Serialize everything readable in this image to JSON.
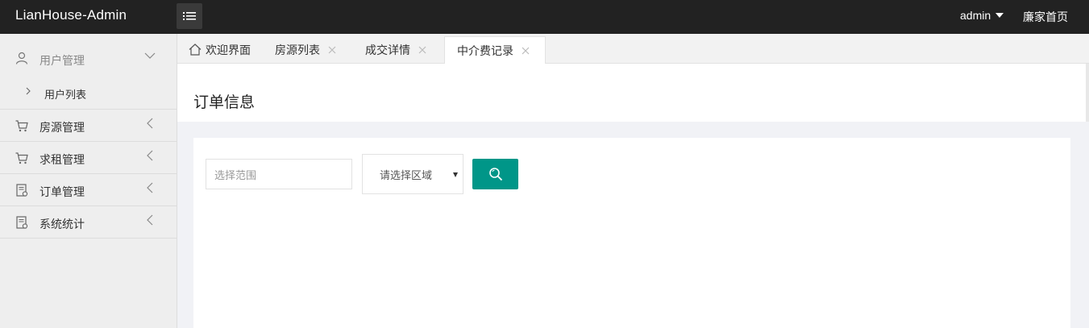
{
  "app": {
    "brand": "LianHouse-Admin",
    "user": "admin",
    "home_link": "廉家首页"
  },
  "sidebar": {
    "groups": [
      {
        "label": "用户管理",
        "icon": "user-icon",
        "expanded": true,
        "children": [
          {
            "label": "用户列表"
          }
        ]
      },
      {
        "label": "房源管理",
        "icon": "cart-icon"
      },
      {
        "label": "求租管理",
        "icon": "cart-icon"
      },
      {
        "label": "订单管理",
        "icon": "order-icon"
      },
      {
        "label": "系统统计",
        "icon": "order-icon"
      }
    ]
  },
  "tabs": [
    {
      "label": "欢迎界面",
      "icon": "home-icon",
      "closable": false
    },
    {
      "label": "房源列表",
      "closable": true
    },
    {
      "label": "成交详情",
      "closable": true
    },
    {
      "label": "中介费记录",
      "closable": true,
      "active": true
    }
  ],
  "page": {
    "title": "订单信息"
  },
  "filters": {
    "range_placeholder": "选择范围",
    "region_selected": "请选择区域"
  },
  "colors": {
    "topbar": "#222222",
    "accent": "#009688"
  }
}
